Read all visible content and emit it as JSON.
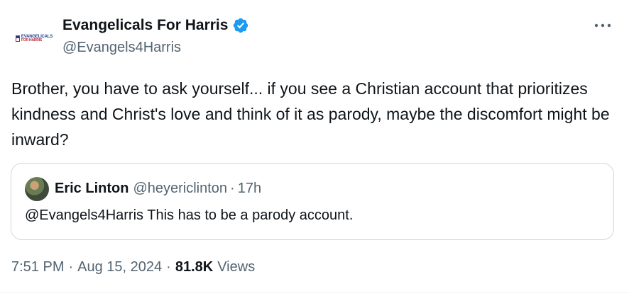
{
  "author": {
    "display_name": "Evangelicals For Harris",
    "handle": "@Evangels4Harris",
    "verified": true,
    "logo_line1": "EVANGELICALS",
    "logo_line2": "FOR HARRIS",
    "verified_color": "#1d9bf0"
  },
  "tweet": {
    "text": "Brother, you have to ask yourself... if you see a Christian account that prioritizes kindness and Christ's love and think of it as parody, maybe the discomfort might be inward?"
  },
  "quoted_tweet": {
    "display_name": "Eric Linton",
    "handle": "@heyericlinton",
    "separator": "·",
    "time": "17h",
    "text": "@Evangels4Harris This has to be a parody account."
  },
  "meta": {
    "time": "7:51 PM",
    "separator": "·",
    "date": "Aug 15, 2024",
    "views_count": "81.8K",
    "views_label": "Views"
  },
  "icons": {
    "more": "more-horizontal-icon",
    "verified": "verified-badge-icon"
  },
  "colors": {
    "text_primary": "#0f1419",
    "text_secondary": "#536471",
    "border": "#cfd9de",
    "accent": "#1d9bf0"
  }
}
